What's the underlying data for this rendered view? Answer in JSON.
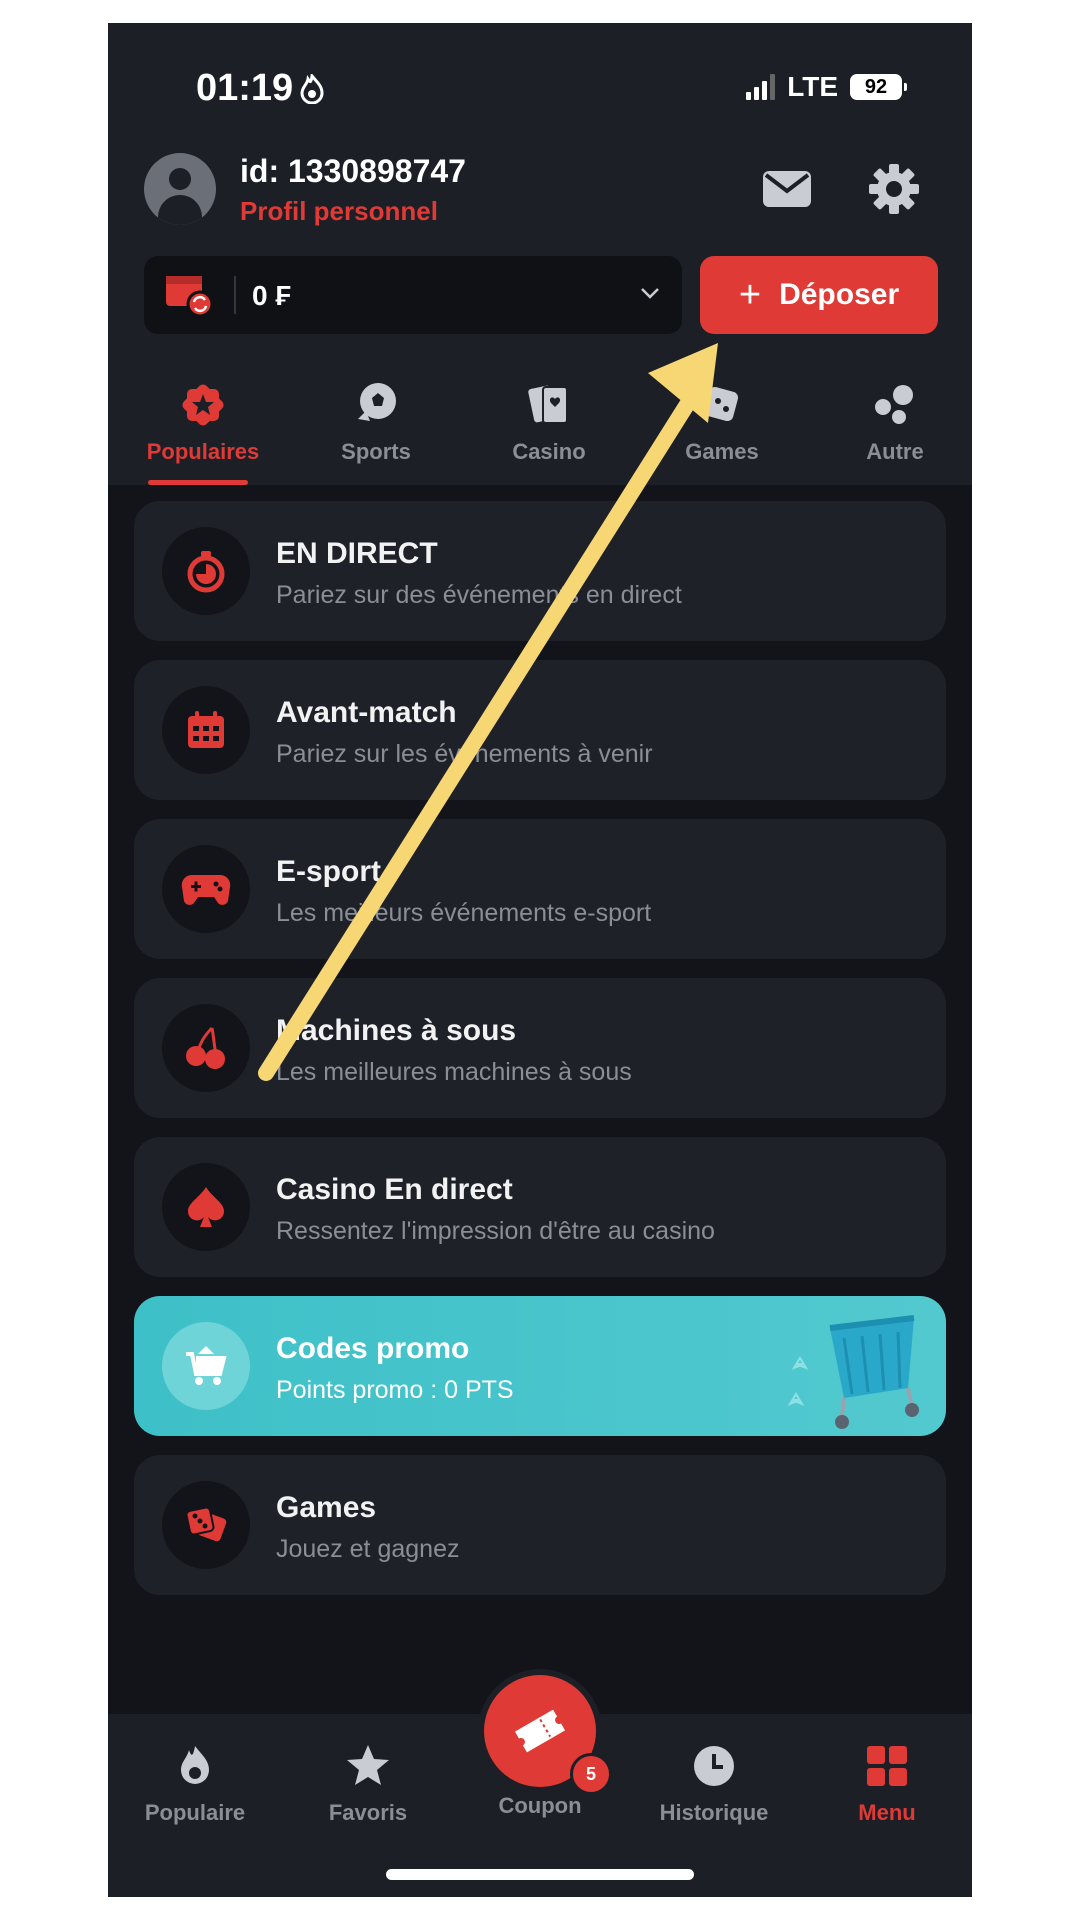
{
  "status_bar": {
    "time": "01:19",
    "network": "LTE",
    "battery": "92"
  },
  "profile": {
    "id_text": "id: 1330898747",
    "link_label": "Profil personnel"
  },
  "balance": {
    "value": "0 ₣"
  },
  "deposit": {
    "label": "Déposer"
  },
  "tabs": [
    {
      "label": "Populaires",
      "icon": "badge-star-icon",
      "active": true
    },
    {
      "label": "Sports",
      "icon": "soccer-ball-icon"
    },
    {
      "label": "Casino",
      "icon": "cards-icon"
    },
    {
      "label": "Games",
      "icon": "games-icon"
    },
    {
      "label": "Autre",
      "icon": "dots-icon"
    }
  ],
  "menu": [
    {
      "title": "EN DIRECT",
      "subtitle": "Pariez sur des événements en direct",
      "icon": "stopwatch-icon"
    },
    {
      "title": "Avant-match",
      "subtitle": "Pariez sur les événements à venir",
      "icon": "calendar-icon"
    },
    {
      "title": "E-sport",
      "subtitle": "Les meilleurs événements e-sport",
      "icon": "gamepad-icon"
    },
    {
      "title": "Machines à sous",
      "subtitle": "Les meilleures machines à sous",
      "icon": "cherries-icon"
    },
    {
      "title": "Casino En direct",
      "subtitle": "Ressentez l'impression d'être au casino",
      "icon": "spade-icon"
    },
    {
      "title": "Codes promo",
      "subtitle": "Points promo : 0 PTS",
      "icon": "cart-icon"
    },
    {
      "title": "Games",
      "subtitle": "Jouez et gagnez",
      "icon": "dice-icon"
    }
  ],
  "bottom_nav": [
    {
      "label": "Populaire",
      "icon": "flame-icon"
    },
    {
      "label": "Favoris",
      "icon": "star-icon"
    },
    {
      "label": "Coupon",
      "icon": "ticket-icon",
      "badge": "5"
    },
    {
      "label": "Historique",
      "icon": "clock-icon"
    },
    {
      "label": "Menu",
      "icon": "grid-icon",
      "active": true
    }
  ],
  "colors": {
    "accent": "#e03a36",
    "background": "#121419",
    "surface": "#1e2128",
    "promo": "#4fc6cc",
    "annotation_arrow": "#f7d774"
  }
}
